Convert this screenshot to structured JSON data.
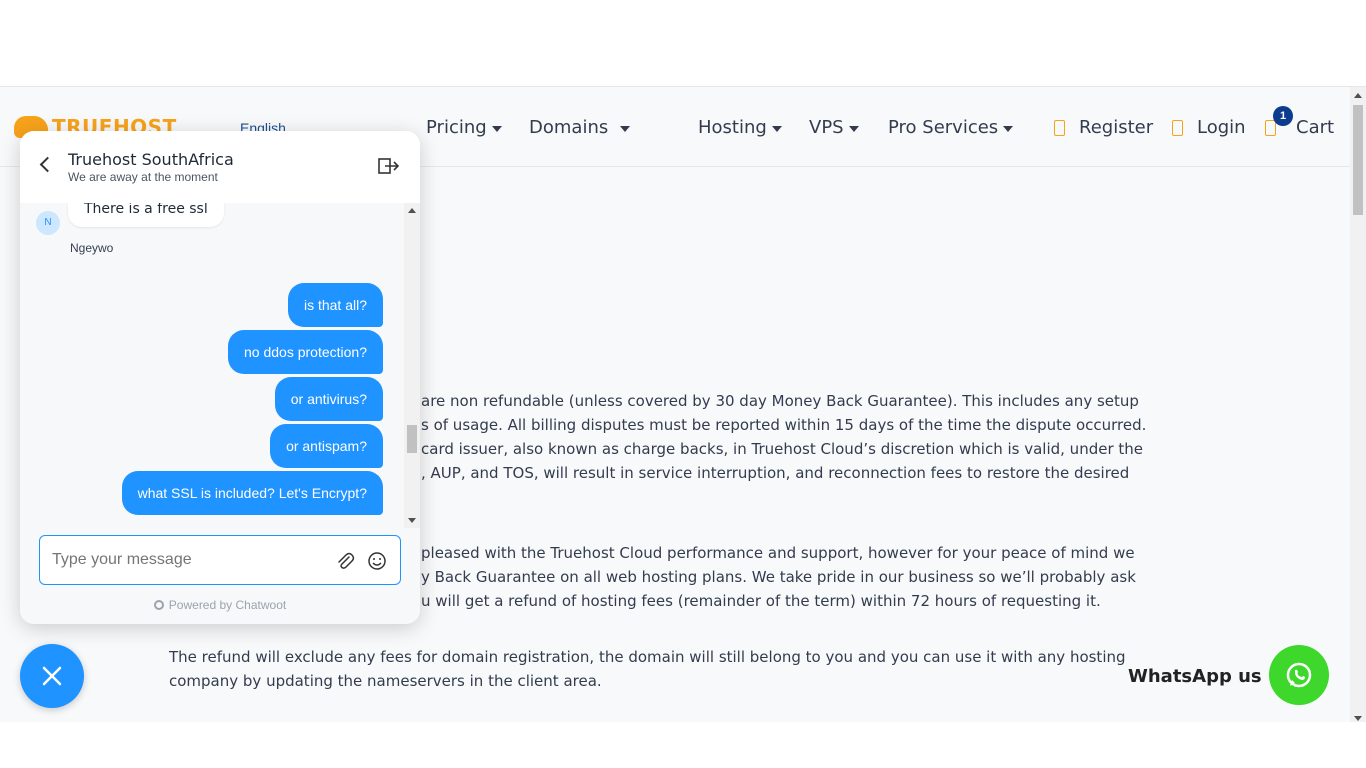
{
  "navbar": {
    "logo_text": "TRUEHOST",
    "language": "English",
    "items": [
      {
        "label": "Pricing"
      },
      {
        "label": "Domains"
      },
      {
        "label": "Hosting"
      },
      {
        "label": "VPS"
      },
      {
        "label": "Pro Services"
      }
    ],
    "register": "Register",
    "login": "Login",
    "cart": "Cart",
    "cart_count": "1"
  },
  "content": {
    "lines": [
      "are non refundable (unless covered by 30 day Money Back Guarantee). This includes any setup",
      "s of usage. All billing disputes must be reported within 15 days of the time the dispute occurred.",
      "card issuer, also known as charge backs, in Truehost Cloud’s discretion which is valid, under the",
      ", AUP, and TOS, will result in service interruption, and reconnection fees to restore the desired",
      "pleased with the Truehost Cloud performance and support, however for your peace of mind we",
      "y Back Guarantee on all web hosting plans. We take pride in our business so we’ll probably ask",
      "u will get a refund of hosting fees (remainder of the term) within 72 hours of requesting it.",
      "The refund will exclude any fees for domain registration, the domain will still belong to you and you can use it with any hosting",
      "company by updating the nameservers in the client area."
    ]
  },
  "whatsapp": {
    "label": "WhatsApp us"
  },
  "chat": {
    "title": "Truehost SouthAfrica",
    "subtitle": "We are away at the moment",
    "agent_message": "There is a free ssl",
    "agent_initial": "N",
    "agent_name": "Ngeywo",
    "user_messages": [
      "is that all?",
      "no ddos protection?",
      "or antivirus?",
      "or antispam?",
      "what SSL is included? Let's Encrypt?"
    ],
    "input_placeholder": "Type your message",
    "powered_by": "Powered by Chatwoot"
  },
  "colors": {
    "brand_orange": "#f7a21b",
    "chat_blue": "#1f93ff",
    "whatsapp_green": "#3dd82b",
    "badge_navy": "#0d3b8e"
  },
  "icons": [
    "back-arrow-icon",
    "exit-icon",
    "attach-icon",
    "emoji-icon",
    "close-icon",
    "whatsapp-icon",
    "user-icon",
    "login-icon",
    "cart-icon",
    "chatwoot-logo-icon"
  ]
}
